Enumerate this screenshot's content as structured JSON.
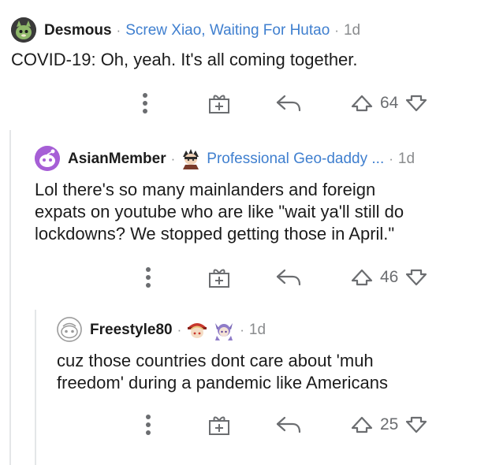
{
  "comments": [
    {
      "username": "Desmous",
      "flair": "Screw Xiao, Waiting For Hutao",
      "separator": "·",
      "time": "1d",
      "body": "COVID-19: Oh, yeah. It's all coming together.",
      "score": "64",
      "avatar_icon": "avatar-cat-green",
      "flair_icons": []
    },
    {
      "username": "AsianMember",
      "flair": "Professional Geo-daddy ...",
      "separator": "·",
      "time": "1d",
      "body": "Lol there's so many mainlanders and foreign\nexpats on youtube who are like \"wait ya'll still do\nlockdowns? We stopped getting those in April.\"",
      "score": "46",
      "avatar_icon": "avatar-snoo-purple",
      "flair_icons": [
        "flair-character-icon"
      ]
    },
    {
      "username": "Freestyle80",
      "flair": "",
      "separator": "·",
      "time": "1d",
      "body": "cuz those countries dont care about 'muh\nfreedom' during a pandemic like Americans",
      "score": "25",
      "avatar_icon": "avatar-snoo-grey",
      "flair_icons": [
        "flair-klee-icon",
        "flair-keqing-icon"
      ]
    }
  ],
  "icons": {
    "more": "more-vertical-icon",
    "award": "gift-award-icon",
    "reply": "reply-arrow-icon",
    "upvote": "upvote-icon",
    "downvote": "downvote-icon"
  },
  "colors": {
    "flair": "#3f7fcf",
    "meta": "#8a8c8e",
    "icon": "#6b6d70",
    "thread": "#e4e6e8"
  }
}
